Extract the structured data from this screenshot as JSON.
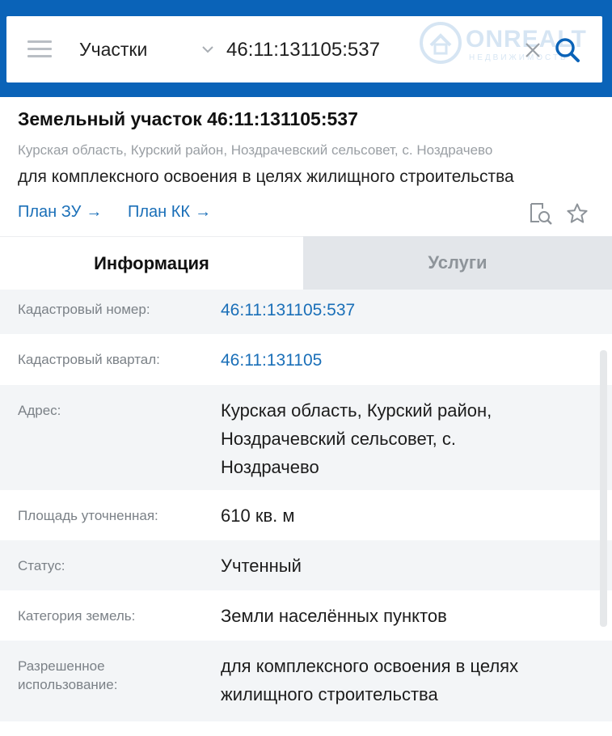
{
  "search": {
    "category": "Участки",
    "query": "46:11:131105:537",
    "watermark_text": "ONREALT",
    "watermark_sub": "НЕДВИЖИМОСТЬ"
  },
  "parcel": {
    "title": "Земельный участок 46:11:131105:537",
    "address_line": "Курская область, Курский район, Ноздрачевский сельсовет, с. Ноздрачево",
    "purpose": "для комплексного освоения в целях жилищного строительства",
    "links": [
      {
        "label": "План ЗУ",
        "arrow": "→"
      },
      {
        "label": "План КК",
        "arrow": "→"
      }
    ]
  },
  "tabs": [
    {
      "label": "Информация",
      "active": true
    },
    {
      "label": "Услуги",
      "active": false
    }
  ],
  "info_rows": [
    {
      "key": "Кадастровый номер:",
      "value": "46:11:131105:537",
      "is_link": true
    },
    {
      "key": "Кадастровый квартал:",
      "value": "46:11:131105",
      "is_link": true
    },
    {
      "key": "Адрес:",
      "value_lines": [
        "Курская область, Курский район,",
        "Ноздрачевский сельсовет, с.",
        "Ноздрачево"
      ]
    },
    {
      "key": "Площадь уточненная:",
      "value": "610 кв. м"
    },
    {
      "key": "Статус:",
      "value": "Учтенный"
    },
    {
      "key": "Категория земель:",
      "value": "Земли населённых пунктов"
    },
    {
      "key_lines": [
        "Разрешенное",
        "использование:"
      ],
      "value_lines": [
        "для комплексного освоения в целях",
        "жилищного строительства"
      ]
    }
  ],
  "colors": {
    "brand_blue": "#0a63b8",
    "link_blue": "#1a6fb8",
    "row_shade": "#f3f5f7",
    "tab_inactive_bg": "#e3e6ea"
  },
  "icons": {
    "menu": "hamburger-menu-icon",
    "dropdown": "chevron-down-icon",
    "clear": "close-icon",
    "search": "search-icon",
    "doc_search": "document-search-icon",
    "favorite": "star-icon",
    "watermark": "house-logo-icon"
  }
}
